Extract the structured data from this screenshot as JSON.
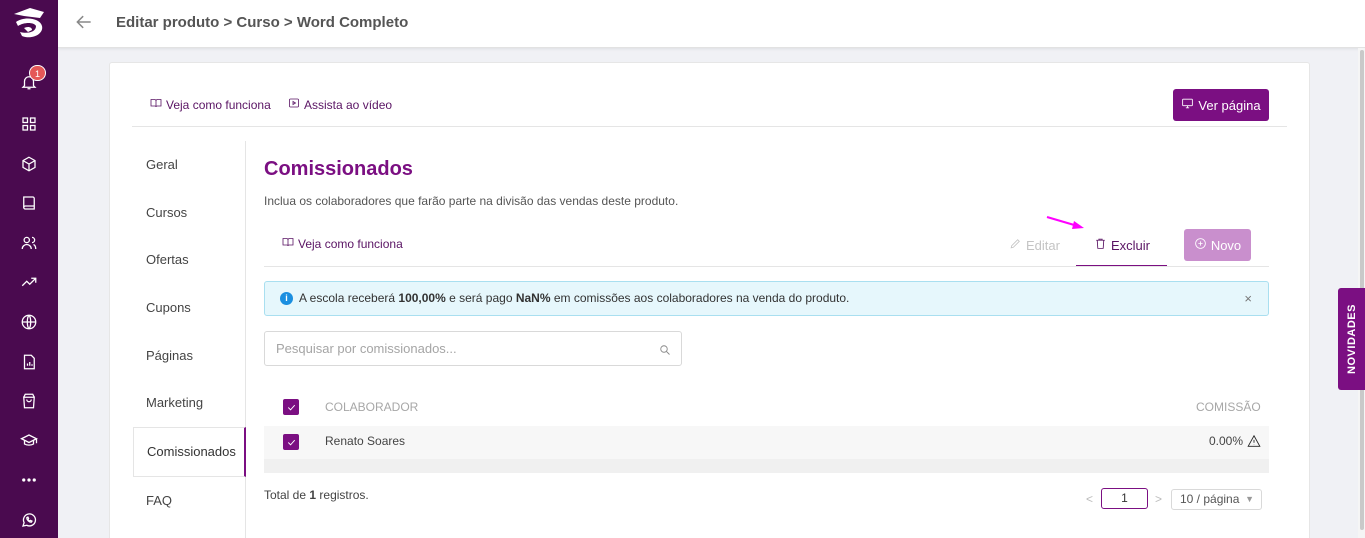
{
  "sidebar": {
    "notification_count": "1",
    "icons": [
      "bell-icon",
      "grid-icon",
      "box-icon",
      "book-icon",
      "users-icon",
      "trending-up-icon",
      "globe-icon",
      "report-icon",
      "shopping-bag-icon",
      "graduation-cap-icon",
      "more-icon",
      "whatsapp-icon"
    ]
  },
  "header": {
    "breadcrumb": "Editar produto > Curso > Word Completo"
  },
  "help_links": {
    "how_it_works": "Veja como funciona",
    "watch_video": "Assista ao vídeo"
  },
  "view_page_button": "Ver página",
  "nav": {
    "items": [
      "Geral",
      "Cursos",
      "Ofertas",
      "Cupons",
      "Páginas",
      "Marketing",
      "Comissionados",
      "FAQ"
    ],
    "active": "Comissionados"
  },
  "section": {
    "title": "Comissionados",
    "subtitle": "Inclua os colaboradores que farão parte na divisão das vendas deste produto.",
    "how_it_works": "Veja como funciona"
  },
  "actions": {
    "edit": "Editar",
    "delete": "Excluir",
    "new": "Novo"
  },
  "alert": {
    "prefix": "A escola receberá ",
    "school_percent": "100,00%",
    "middle": " e será pago ",
    "paid_percent": "NaN%",
    "suffix": " em comissões aos colaboradores na venda do produto.",
    "close": "×"
  },
  "search": {
    "placeholder": "Pesquisar por comissionados...",
    "value": ""
  },
  "table": {
    "columns": [
      "COLABORADOR",
      "COMISSÃO"
    ],
    "rows": [
      {
        "collaborator": "Renato Soares",
        "commission": "0.00%",
        "checked": true
      }
    ],
    "header_checked": true
  },
  "footer": {
    "total_prefix": "Total de ",
    "total_count": "1",
    "total_suffix": " registros.",
    "page": "1",
    "page_size": "10 / página",
    "prev": "<",
    "next": ">"
  },
  "side_tab": "NOVIDADES",
  "colors": {
    "brand": "#7b0f82",
    "sidebar": "#4a0a4f",
    "annotation_arrow": "#ff00ff"
  }
}
